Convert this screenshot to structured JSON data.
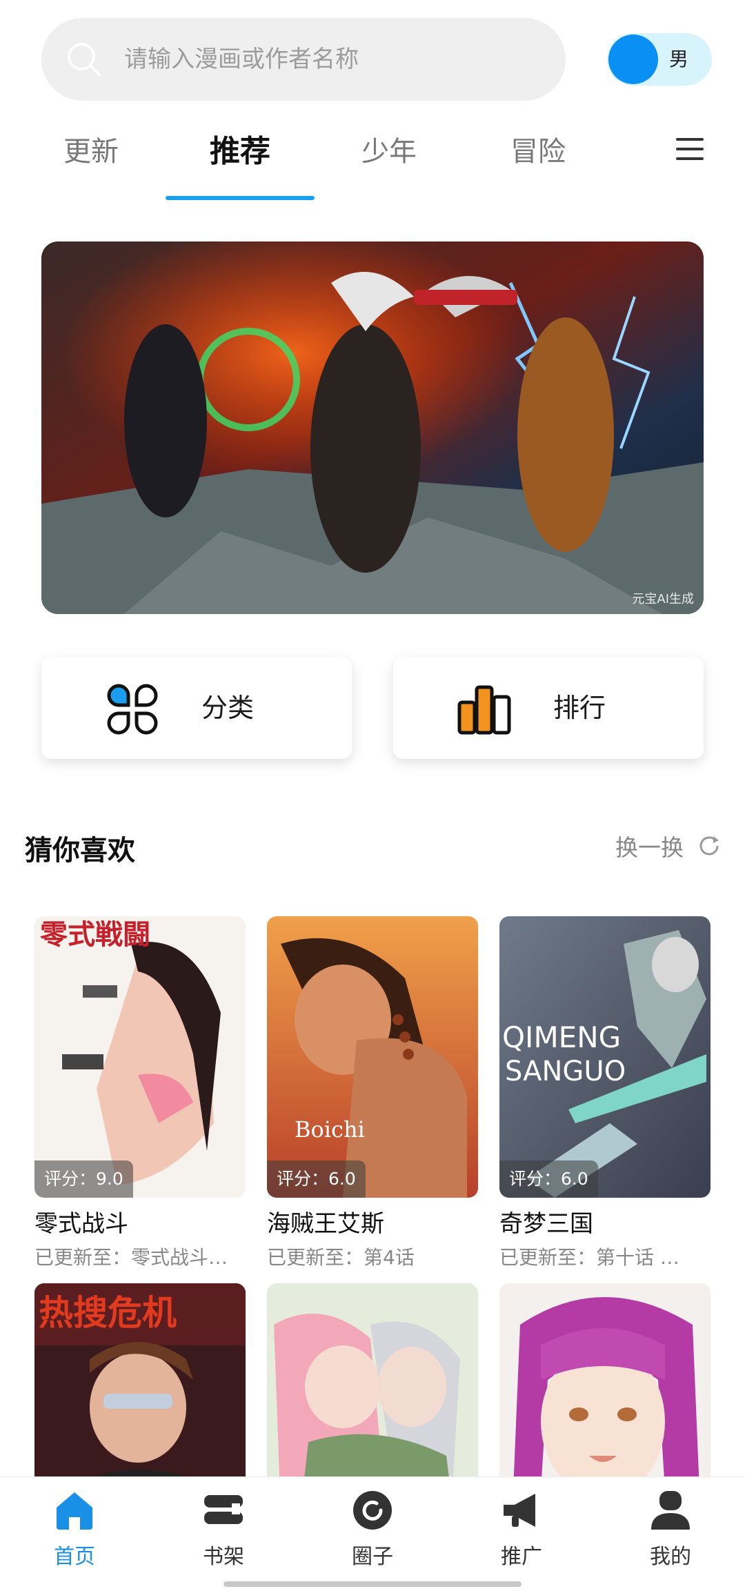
{
  "search": {
    "placeholder": "请输入漫画或作者名称",
    "icon": "search-icon"
  },
  "gender_toggle": {
    "label": "男",
    "active_color": "#0a8ff5"
  },
  "tabs": [
    {
      "label": "更新"
    },
    {
      "label": "推荐",
      "active": true
    },
    {
      "label": "少年"
    },
    {
      "label": "冒险"
    }
  ],
  "tab_menu_icon": "menu-icon",
  "banner": {
    "watermark": "元宝AI生成"
  },
  "quick_actions": [
    {
      "label": "分类",
      "icon": "category-icon"
    },
    {
      "label": "排行",
      "icon": "ranking-icon"
    }
  ],
  "recommend": {
    "title": "猜你喜欢",
    "refresh_label": "换一换",
    "items": [
      {
        "title": "零式战斗",
        "score": "评分：9.0",
        "update": "已更新至：零式战斗…",
        "cover_text": "零式戦闘"
      },
      {
        "title": "海贼王艾斯",
        "score": "评分：6.0",
        "update": "已更新至：第4话",
        "cover_text": "Boichi"
      },
      {
        "title": "奇梦三国",
        "score": "评分：6.0",
        "update": "已更新至：第十话 …",
        "cover_text": "QIMENG SANGUO"
      },
      {
        "title": "",
        "score": "",
        "update": "",
        "cover_text": "热搜危机"
      },
      {
        "title": "",
        "score": "",
        "update": "",
        "cover_text": ""
      },
      {
        "title": "",
        "score": "",
        "update": "",
        "cover_text": ""
      }
    ]
  },
  "bottom_nav": [
    {
      "label": "首页",
      "icon": "home-icon",
      "active": true
    },
    {
      "label": "书架",
      "icon": "bookshelf-icon"
    },
    {
      "label": "圈子",
      "icon": "circle-icon"
    },
    {
      "label": "推广",
      "icon": "megaphone-icon"
    },
    {
      "label": "我的",
      "icon": "profile-icon"
    }
  ],
  "colors": {
    "accent": "#1a9ef0",
    "nav_active": "#1a8fe6"
  }
}
